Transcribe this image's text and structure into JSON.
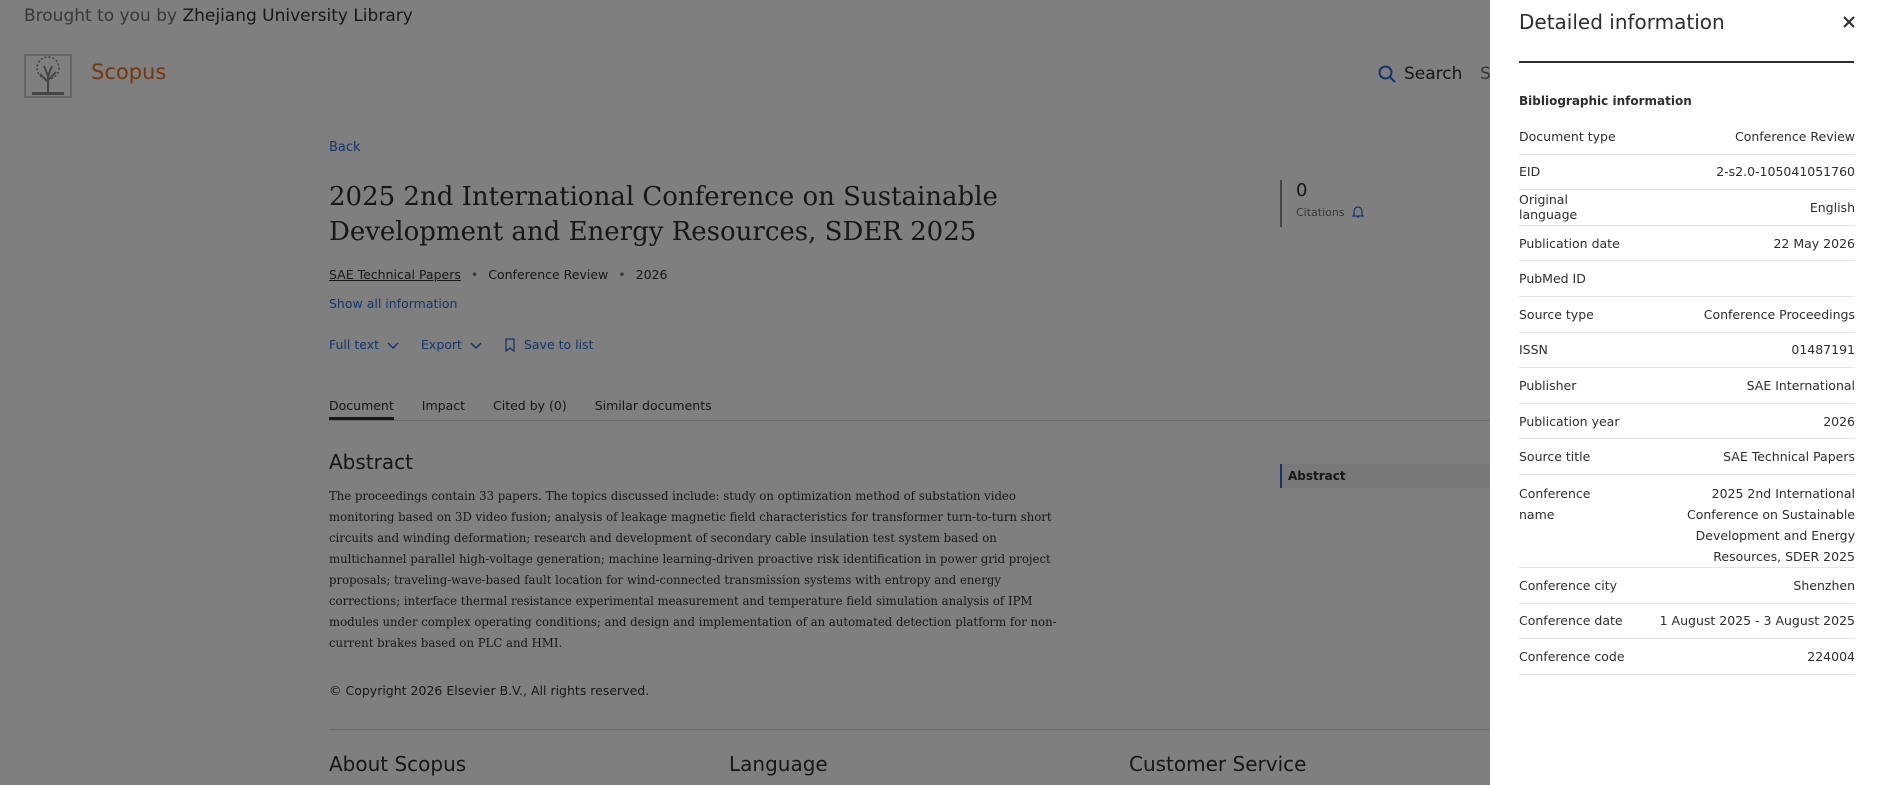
{
  "header": {
    "brought_prefix": "Brought to you by",
    "institution": "Zhejiang University Library",
    "brand": "Scopus",
    "search_label": "Search",
    "more_label": "S"
  },
  "doc": {
    "back": "Back",
    "title": "2025 2nd International Conference on Sustainable Development and Energy Resources, SDER 2025",
    "source": "SAE Technical Papers",
    "doc_type": "Conference Review",
    "year": "2026",
    "show_all": "Show all information",
    "actions": {
      "full_text": "Full text",
      "export": "Export",
      "save": "Save to list"
    },
    "citations": {
      "count": "0",
      "label": "Citations"
    },
    "tabs": [
      "Document",
      "Impact",
      "Cited by (0)",
      "Similar documents"
    ],
    "abstract_heading": "Abstract",
    "abstract_text": "The proceedings contain 33 papers. The topics discussed include: study on optimization method of substation video monitoring based on 3D video fusion; analysis of leakage magnetic field characteristics for transformer turn-to-turn short circuits and winding deformation; research and development of secondary cable insulation test system based on multichannel parallel high-voltage generation; machine learning-driven proactive risk identification in power grid project proposals; traveling-wave-based fault location for wind-connected transmission systems with entropy and energy corrections; interface thermal resistance experimental measurement and temperature field simulation analysis of IPM modules under complex operating conditions; and design and implementation of an automated detection platform for non-current brakes based on PLC and HMI.",
    "outline_item": "Abstract",
    "copyright": "Copyright 2026 Elsevier B.V., All rights reserved.",
    "footer": [
      "About Scopus",
      "Language",
      "Customer Service"
    ]
  },
  "panel": {
    "title": "Detailed information",
    "section": "Bibliographic information",
    "rows": [
      {
        "k": "Document type",
        "v": "Conference Review"
      },
      {
        "k": "EID",
        "v": "2-s2.0-105041051760"
      },
      {
        "k": "Original language",
        "v": "English"
      },
      {
        "k": "Publication date",
        "v": "22 May 2026"
      },
      {
        "k": "PubMed ID",
        "v": ""
      },
      {
        "k": "Source type",
        "v": "Conference Proceedings"
      },
      {
        "k": "ISSN",
        "v": "01487191"
      },
      {
        "k": "Publisher",
        "v": "SAE International"
      },
      {
        "k": "Publication year",
        "v": "2026"
      },
      {
        "k": "Source title",
        "v": "SAE Technical Papers"
      },
      {
        "k": "Conference name",
        "v": "2025 2nd International Conference on Sustainable Development and Energy Resources, SDER 2025"
      },
      {
        "k": "Conference city",
        "v": "Shenzhen"
      },
      {
        "k": "Conference date",
        "v": "1 August 2025 - 3 August 2025"
      },
      {
        "k": "Conference code",
        "v": "224004"
      }
    ]
  },
  "colors": {
    "brand": "#e9711c",
    "link": "#2e6bd6",
    "overlay": "rgba(0,0,0,0.5)"
  }
}
